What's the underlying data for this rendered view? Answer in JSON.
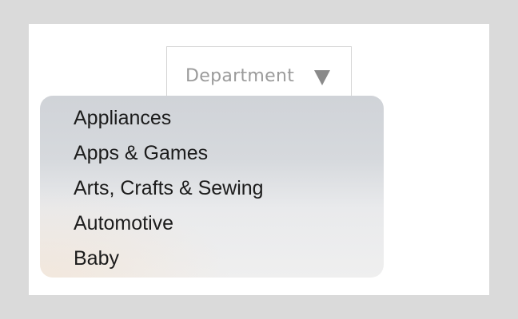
{
  "select": {
    "placeholder": "Department",
    "arrow_icon": "triangle-down-icon"
  },
  "dropdown": {
    "options": [
      {
        "label": "Appliances"
      },
      {
        "label": "Apps & Games"
      },
      {
        "label": "Arts, Crafts & Sewing"
      },
      {
        "label": "Automotive"
      },
      {
        "label": "Baby"
      }
    ]
  },
  "colors": {
    "background": "#dadada",
    "panel": "#ffffff",
    "placeholder_text": "#9b9b9b",
    "option_text": "#1c1c1c"
  }
}
